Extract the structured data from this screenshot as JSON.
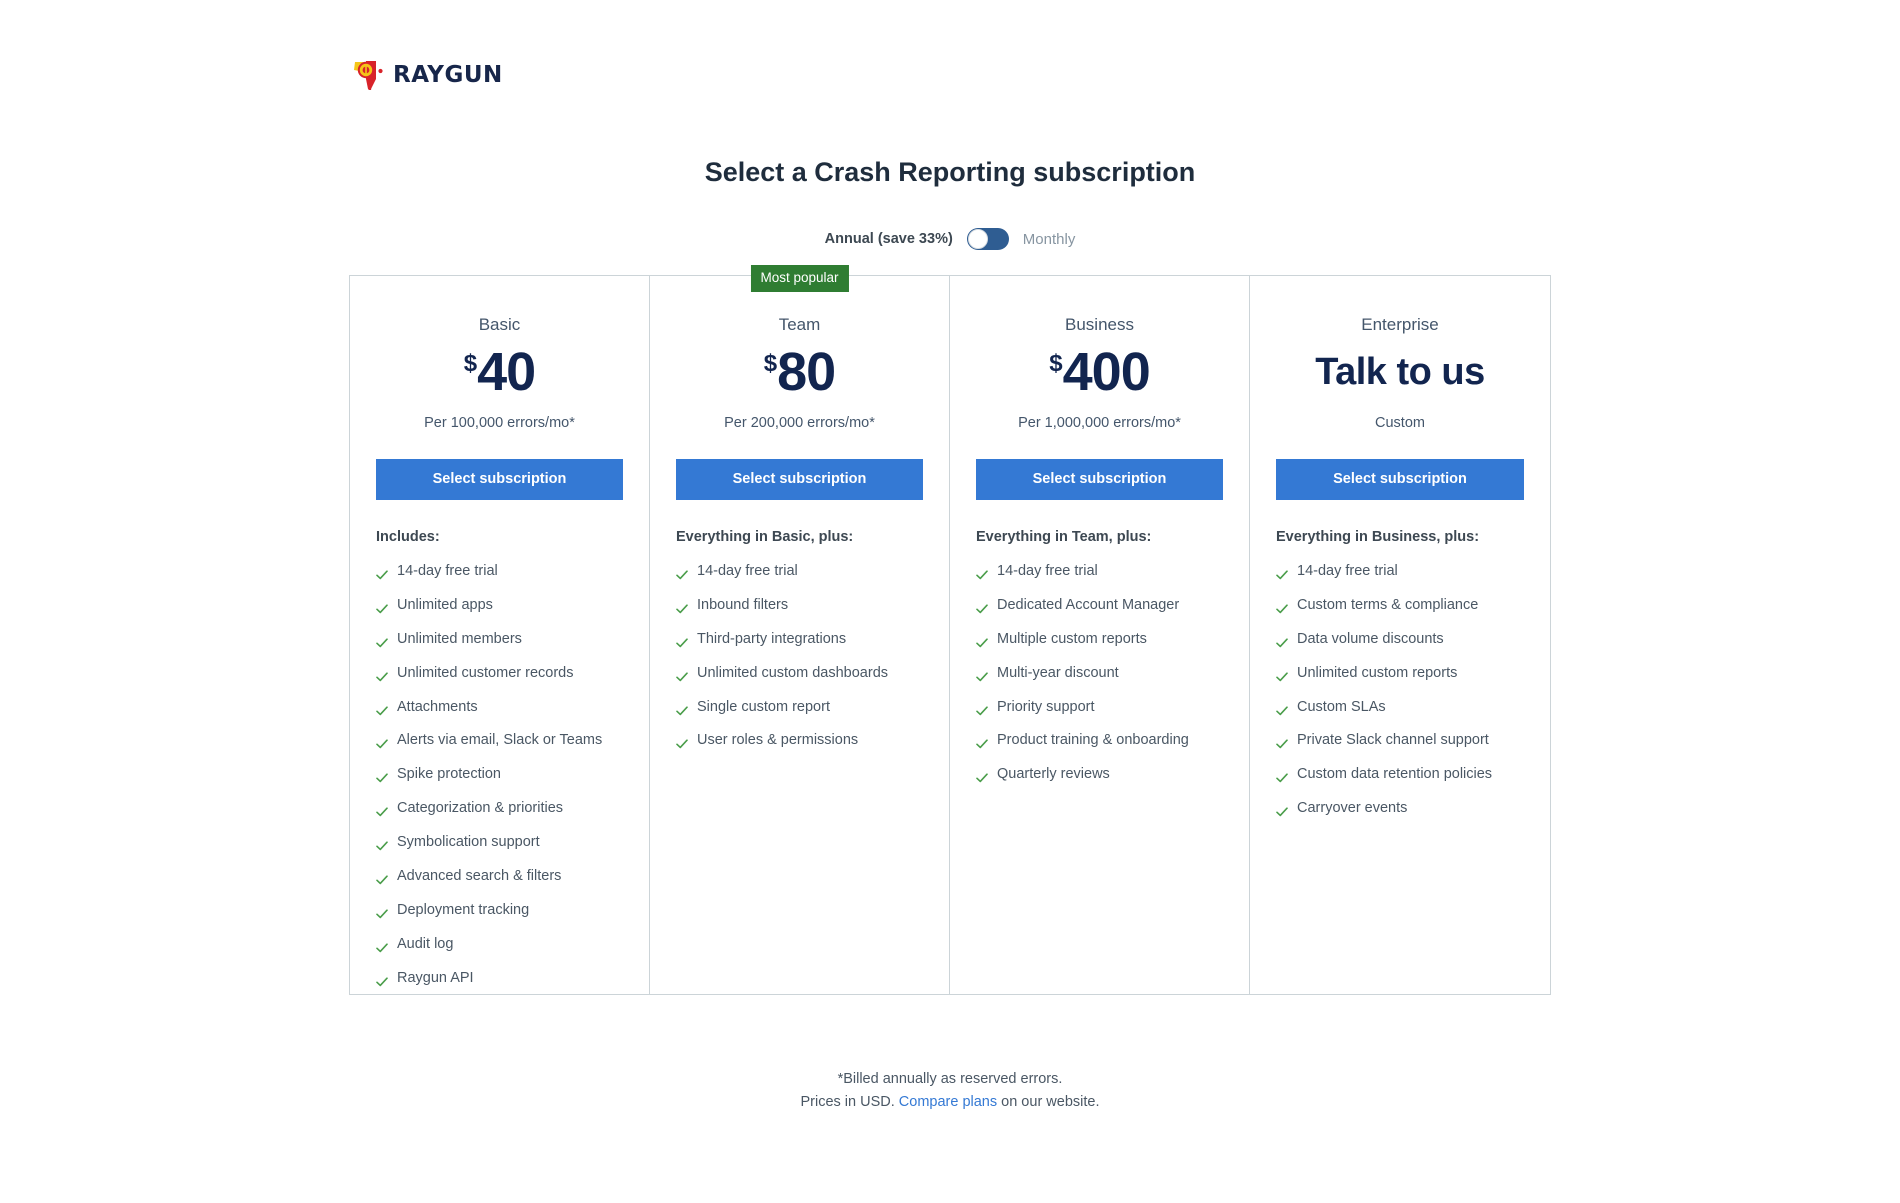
{
  "brand": {
    "name": "RAYGUN",
    "logo_icon": "raygun-logo-icon"
  },
  "header": {
    "title": "Select a Crash Reporting subscription"
  },
  "billing_toggle": {
    "annual_label": "Annual (save 33%)",
    "monthly_label": "Monthly",
    "selected": "Annual",
    "track_color": "#2f5d92",
    "knob_position": "left"
  },
  "colors": {
    "accent_button": "#3479d4",
    "badge_green": "#2f7d32",
    "price_navy": "#12254f",
    "check_green": "#4a9d4a",
    "border": "#ccd4d8",
    "link": "#3479d4"
  },
  "plans": [
    {
      "name": "Basic",
      "badge": null,
      "currency": "$",
      "amount": "40",
      "price_text": null,
      "sub": "Per 100,000 errors/mo*",
      "cta": "Select subscription",
      "includes_title": "Includes:",
      "features": [
        "14-day free trial",
        "Unlimited apps",
        "Unlimited members",
        "Unlimited customer records",
        "Attachments",
        "Alerts via email, Slack or Teams",
        "Spike protection",
        "Categorization & priorities",
        "Symbolication support",
        "Advanced search & filters",
        "Deployment tracking",
        "Audit log",
        "Raygun API"
      ]
    },
    {
      "name": "Team",
      "badge": "Most popular",
      "currency": "$",
      "amount": "80",
      "price_text": null,
      "sub": "Per 200,000 errors/mo*",
      "cta": "Select subscription",
      "includes_title": "Everything in Basic, plus:",
      "features": [
        "14-day free trial",
        "Inbound filters",
        "Third-party integrations",
        "Unlimited custom dashboards",
        "Single custom report",
        "User roles & permissions"
      ]
    },
    {
      "name": "Business",
      "badge": null,
      "currency": "$",
      "amount": "400",
      "price_text": null,
      "sub": "Per 1,000,000 errors/mo*",
      "cta": "Select subscription",
      "includes_title": "Everything in Team, plus:",
      "features": [
        "14-day free trial",
        "Dedicated Account Manager",
        "Multiple custom reports",
        "Multi-year discount",
        "Priority support",
        "Product training & onboarding",
        "Quarterly reviews"
      ]
    },
    {
      "name": "Enterprise",
      "badge": null,
      "currency": null,
      "amount": null,
      "price_text": "Talk to us",
      "sub": "Custom",
      "cta": "Select subscription",
      "includes_title": "Everything in Business, plus:",
      "features": [
        "14-day free trial",
        "Custom terms & compliance",
        "Data volume discounts",
        "Unlimited custom reports",
        "Custom SLAs",
        "Private Slack channel support",
        "Custom data retention policies",
        "Carryover events"
      ]
    }
  ],
  "footer": {
    "line1": "*Billed annually as reserved errors.",
    "line2_before": "Prices in USD. ",
    "link_text": "Compare plans",
    "line2_after": " on our website."
  }
}
